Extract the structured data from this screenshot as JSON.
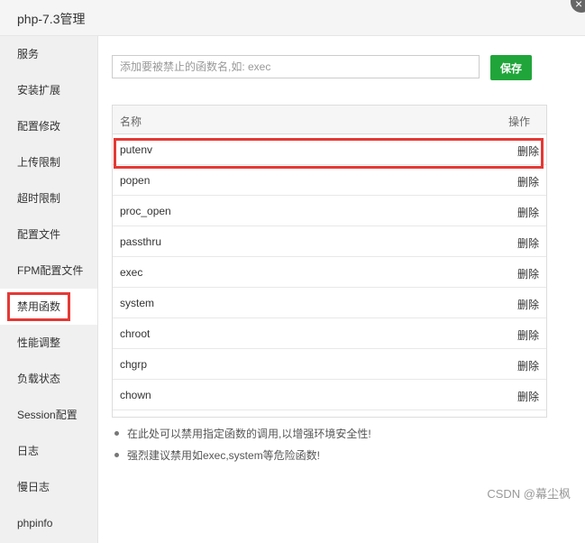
{
  "window": {
    "title": "php-7.3管理",
    "close_glyph": "×"
  },
  "sidebar": {
    "items": [
      {
        "label": "服务"
      },
      {
        "label": "安装扩展"
      },
      {
        "label": "配置修改"
      },
      {
        "label": "上传限制"
      },
      {
        "label": "超时限制"
      },
      {
        "label": "配置文件"
      },
      {
        "label": "FPM配置文件"
      },
      {
        "label": "禁用函数",
        "active": true
      },
      {
        "label": "性能调整"
      },
      {
        "label": "负载状态"
      },
      {
        "label": "Session配置"
      },
      {
        "label": "日志"
      },
      {
        "label": "慢日志"
      },
      {
        "label": "phpinfo"
      }
    ]
  },
  "form": {
    "placeholder": "添加要被禁止的函数名,如: exec",
    "value": "",
    "save_label": "保存"
  },
  "table": {
    "columns": [
      "名称",
      "操作"
    ],
    "rows": [
      {
        "name": "putenv",
        "action": "删除"
      },
      {
        "name": "popen",
        "action": "删除"
      },
      {
        "name": "proc_open",
        "action": "删除"
      },
      {
        "name": "passthru",
        "action": "删除"
      },
      {
        "name": "exec",
        "action": "删除"
      },
      {
        "name": "system",
        "action": "删除"
      },
      {
        "name": "chroot",
        "action": "删除"
      },
      {
        "name": "chgrp",
        "action": "删除"
      },
      {
        "name": "chown",
        "action": "删除"
      }
    ]
  },
  "notes": [
    "在此处可以禁用指定函数的调用,以增强环境安全性!",
    "强烈建议禁用如exec,system等危险函数!"
  ],
  "watermark": "CSDN @幕尘枫",
  "colors": {
    "accent": "#20a53a",
    "highlight": "#e53935"
  }
}
